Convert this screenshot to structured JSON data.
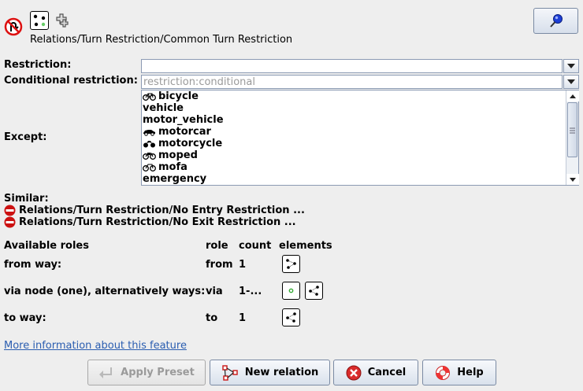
{
  "header": {
    "preset_path": "Relations/Turn Restriction/Common Turn Restriction",
    "pin_icon": "pushpin-icon"
  },
  "form": {
    "restriction_label": "Restriction:",
    "restriction_value": "",
    "conditional_label": "Conditional restriction:",
    "conditional_placeholder": "restriction:conditional",
    "except_label": "Except:",
    "except_items": [
      {
        "label": "bicycle",
        "icon": "bicycle-icon"
      },
      {
        "label": "vehicle",
        "icon": ""
      },
      {
        "label": "motor_vehicle",
        "icon": ""
      },
      {
        "label": "motorcar",
        "icon": "car-icon"
      },
      {
        "label": "motorcycle",
        "icon": "motorcycle-icon"
      },
      {
        "label": "moped",
        "icon": "moped-icon"
      },
      {
        "label": "mofa",
        "icon": "mofa-icon"
      },
      {
        "label": "emergency",
        "icon": ""
      }
    ]
  },
  "similar": {
    "title": "Similar:",
    "items": [
      "Relations/Turn Restriction/No Entry Restriction ...",
      "Relations/Turn Restriction/No Exit Restriction ..."
    ]
  },
  "roles": {
    "headers": [
      "Available roles",
      "role",
      "count",
      "elements"
    ],
    "rows": [
      {
        "name": "from way:",
        "role": "from",
        "count": "1",
        "elements": [
          "way-icon"
        ]
      },
      {
        "name": "via node (one), alternatively ways:",
        "role": "via",
        "count": "1-...",
        "elements": [
          "node-icon",
          "way-icon"
        ]
      },
      {
        "name": "to way:",
        "role": "to",
        "count": "1",
        "elements": [
          "way-icon"
        ]
      }
    ]
  },
  "links": {
    "more_info": "More information about this feature"
  },
  "buttons": {
    "apply": "Apply Preset",
    "new_relation": "New relation",
    "cancel": "Cancel",
    "help": "Help"
  },
  "colors": {
    "accent": "#2a5db0",
    "cancel_red": "#d92b2b",
    "no_entry_red": "#cc1111"
  }
}
